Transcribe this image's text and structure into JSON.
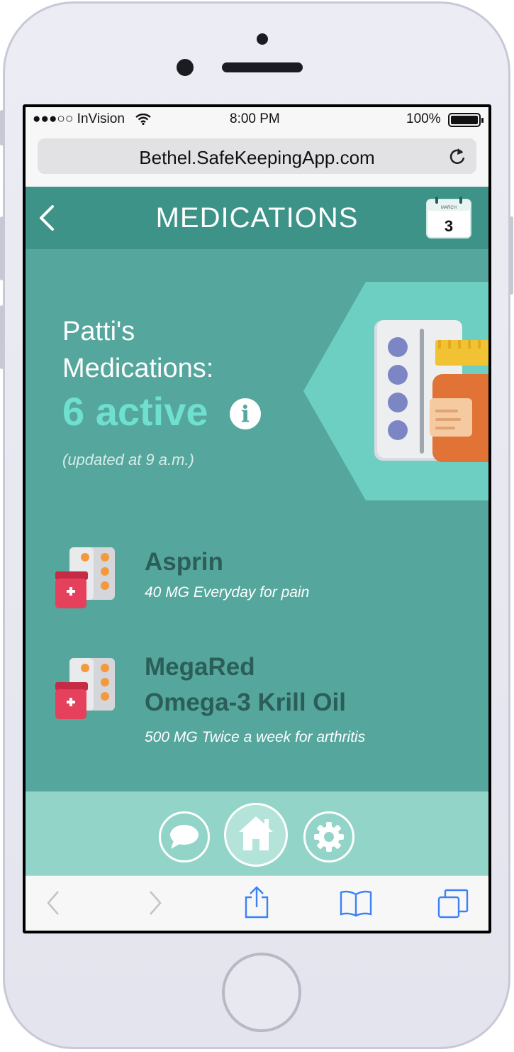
{
  "status_bar": {
    "carrier": "●●●○○ InVision",
    "time": "8:00 PM",
    "battery": "100%"
  },
  "browser": {
    "url": "Bethel.SafeKeepingApp.com",
    "reload_icon": "reload-icon"
  },
  "header": {
    "title": "MEDICATIONS",
    "back_icon": "chevron-left-icon",
    "calendar": {
      "month": "MARCH",
      "day": "3"
    }
  },
  "summary": {
    "line1": "Patti's",
    "line2": "Medications:",
    "active": "6 active",
    "info_symbol": "i",
    "updated": "(updated at 9 a.m.)"
  },
  "medications": [
    {
      "name_lines": [
        "Asprin"
      ],
      "description": "40 MG Everyday for pain",
      "icon": "pill-bottle-icon"
    },
    {
      "name_lines": [
        "MegaRed",
        "Omega-3 Krill Oil"
      ],
      "description": "500 MG Twice a week for arthritis",
      "icon": "pill-bottle-icon"
    }
  ],
  "tabs": [
    {
      "name": "chat",
      "icon": "chat-bubble-icon"
    },
    {
      "name": "home",
      "icon": "home-icon"
    },
    {
      "name": "settings",
      "icon": "gear-icon"
    }
  ],
  "safari_toolbar": [
    "back-arrow-icon",
    "forward-arrow-icon",
    "share-icon",
    "bookmarks-icon",
    "tabs-icon"
  ],
  "colors": {
    "header": "#3d9388",
    "content": "#55a69c",
    "accent": "#6fe0cf",
    "tabbar": "#93d4c8"
  }
}
